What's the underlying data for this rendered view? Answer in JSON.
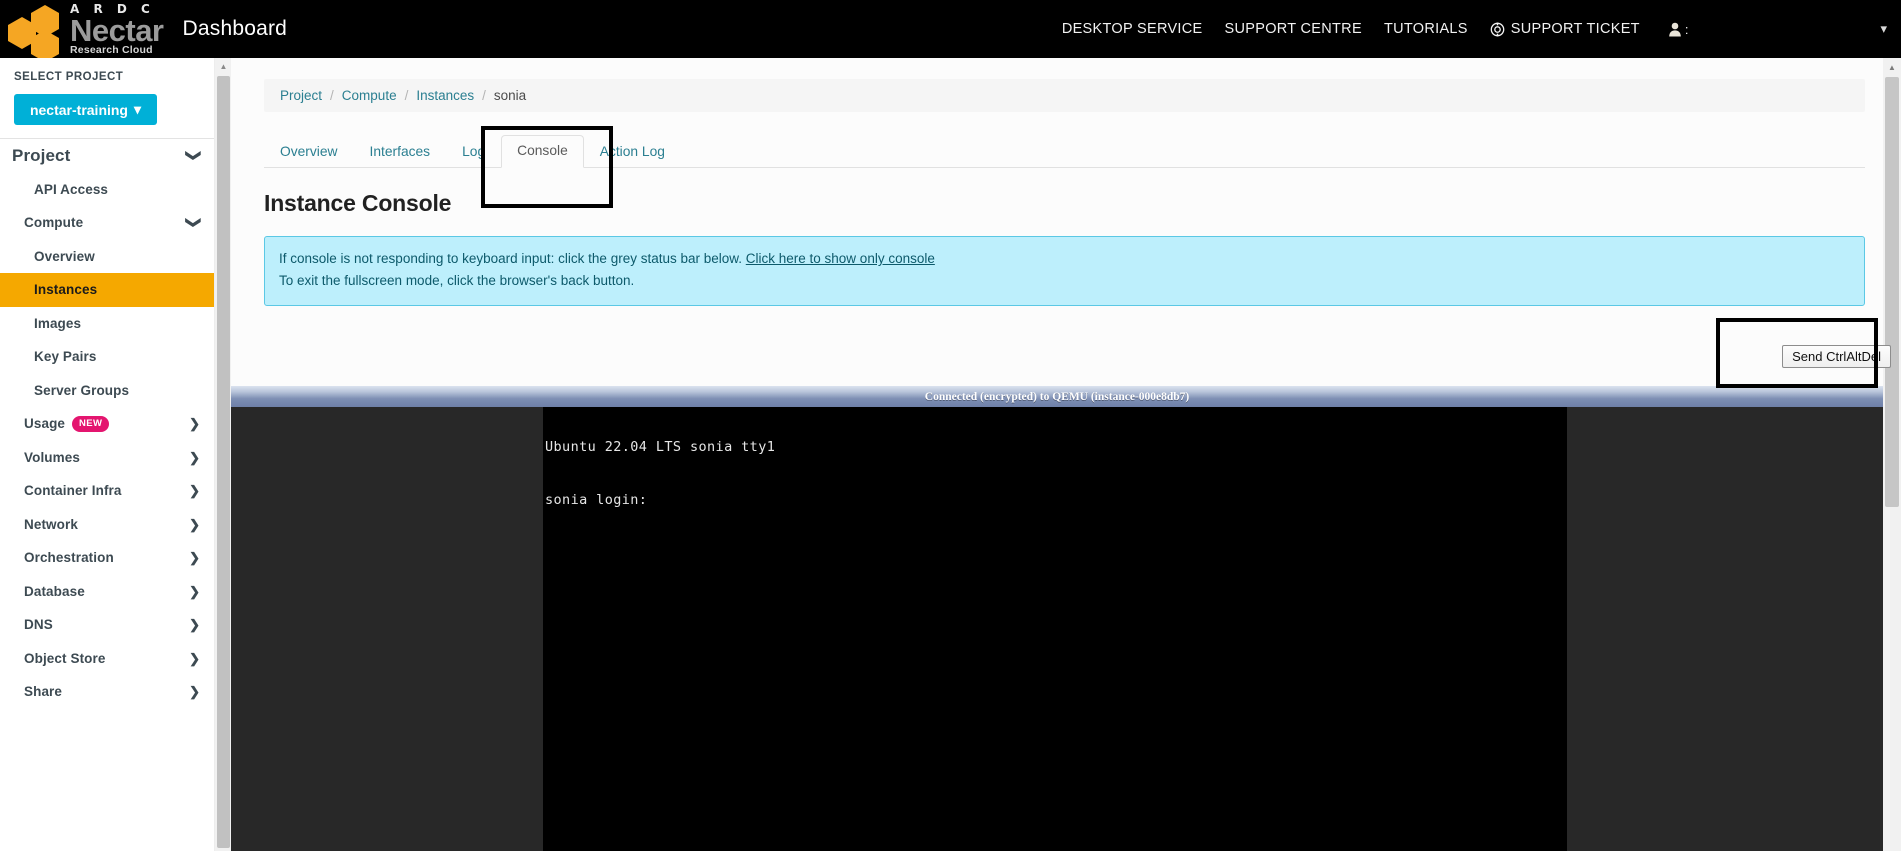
{
  "header": {
    "logo": {
      "ardc": "A R D C",
      "nectar": "Nectar",
      "subtitle": "Research Cloud",
      "icon": "nectar-hexagon-logo"
    },
    "title": "Dashboard",
    "nav": [
      {
        "label": "DESKTOP SERVICE",
        "name": "desktop-service"
      },
      {
        "label": "SUPPORT CENTRE",
        "name": "support-centre"
      },
      {
        "label": "TUTORIALS",
        "name": "tutorials"
      },
      {
        "label": "SUPPORT TICKET",
        "name": "support-ticket",
        "icon": "lifebuoy-icon"
      }
    ],
    "user": {
      "icon": "user-icon",
      "name": ":"
    },
    "caret": "▾"
  },
  "sidebar": {
    "select_project_label": "SELECT PROJECT",
    "project_button": {
      "label": "nectar-training",
      "caret": "▾"
    },
    "items": [
      {
        "label": "Project",
        "level": 1,
        "chevron": "down",
        "active": false,
        "name": "project"
      },
      {
        "label": "API Access",
        "level": 3,
        "chevron": "",
        "active": false,
        "name": "api-access"
      },
      {
        "label": "Compute",
        "level": 2,
        "chevron": "down",
        "active": false,
        "name": "compute"
      },
      {
        "label": "Overview",
        "level": 3,
        "chevron": "",
        "active": false,
        "name": "overview"
      },
      {
        "label": "Instances",
        "level": 3,
        "chevron": "",
        "active": true,
        "name": "instances"
      },
      {
        "label": "Images",
        "level": 3,
        "chevron": "",
        "active": false,
        "name": "images"
      },
      {
        "label": "Key Pairs",
        "level": 3,
        "chevron": "",
        "active": false,
        "name": "key-pairs"
      },
      {
        "label": "Server Groups",
        "level": 3,
        "chevron": "",
        "active": false,
        "name": "server-groups"
      },
      {
        "label": "Usage",
        "level": 2,
        "chevron": "right",
        "active": false,
        "name": "usage",
        "badge": "NEW"
      },
      {
        "label": "Volumes",
        "level": 2,
        "chevron": "right",
        "active": false,
        "name": "volumes"
      },
      {
        "label": "Container Infra",
        "level": 2,
        "chevron": "right",
        "active": false,
        "name": "container-infra"
      },
      {
        "label": "Network",
        "level": 2,
        "chevron": "right",
        "active": false,
        "name": "network"
      },
      {
        "label": "Orchestration",
        "level": 2,
        "chevron": "right",
        "active": false,
        "name": "orchestration"
      },
      {
        "label": "Database",
        "level": 2,
        "chevron": "right",
        "active": false,
        "name": "database"
      },
      {
        "label": "DNS",
        "level": 2,
        "chevron": "right",
        "active": false,
        "name": "dns"
      },
      {
        "label": "Object Store",
        "level": 2,
        "chevron": "right",
        "active": false,
        "name": "object-store"
      },
      {
        "label": "Share",
        "level": 2,
        "chevron": "right",
        "active": false,
        "name": "share"
      }
    ]
  },
  "breadcrumb": [
    {
      "label": "Project",
      "link": true
    },
    {
      "label": "Compute",
      "link": true
    },
    {
      "label": "Instances",
      "link": true
    },
    {
      "label": "sonia",
      "link": false
    }
  ],
  "breadcrumb_separator": "/",
  "tabs": [
    {
      "label": "Overview",
      "active": false,
      "name": "overview"
    },
    {
      "label": "Interfaces",
      "active": false,
      "name": "interfaces"
    },
    {
      "label": "Log",
      "active": false,
      "name": "log"
    },
    {
      "label": "Console",
      "active": true,
      "name": "console"
    },
    {
      "label": "Action Log",
      "active": false,
      "name": "action-log"
    }
  ],
  "page_title": "Instance Console",
  "info_banner": {
    "line1_prefix": "If console is not responding to keyboard input: click the grey status bar below. ",
    "line1_link": "Click here to show only console",
    "line2": "To exit the fullscreen mode, click the browser's back button."
  },
  "console": {
    "status_bar": "Connected (encrypted) to QEMU (instance-000e8db7)",
    "ctrl_alt_del_label": "Send CtrlAltDel",
    "terminal_lines": [
      "Ubuntu 22.04 LTS sonia tty1",
      "",
      "sonia login:"
    ]
  },
  "colors": {
    "brand_orange": "#f5a800",
    "project_cyan": "#00b0d7",
    "link_teal": "#2b7f91",
    "badge_pink": "#e4156f",
    "banner_bg": "#bdeffc",
    "annotation": "#000000"
  }
}
